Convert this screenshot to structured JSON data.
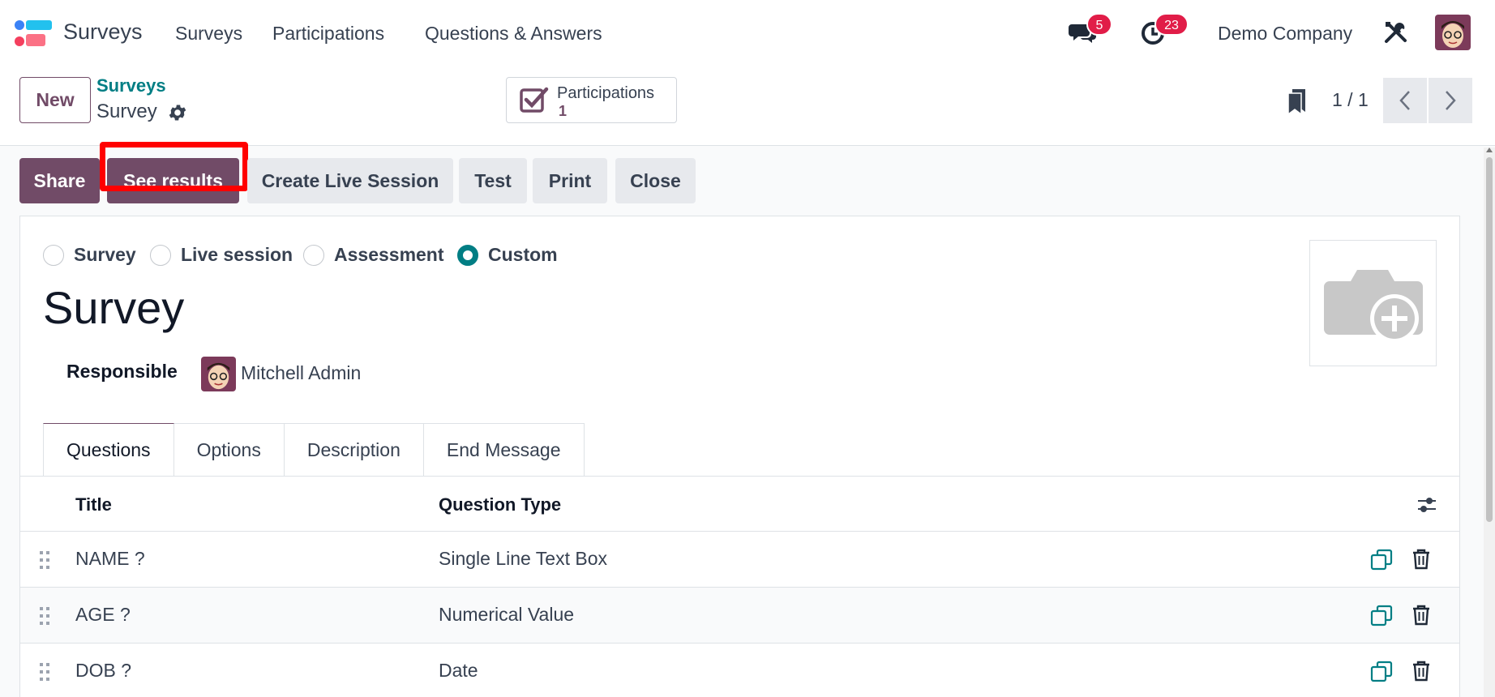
{
  "navbar": {
    "app_name": "Surveys",
    "menu": [
      "Surveys",
      "Participations",
      "Questions & Answers"
    ],
    "messages_badge": "5",
    "activities_badge": "23",
    "company": "Demo Company"
  },
  "control_panel": {
    "new_label": "New",
    "breadcrumb_parent": "Surveys",
    "breadcrumb_current": "Survey",
    "stat_label": "Participations",
    "stat_value": "1",
    "pager_value": "1 / 1"
  },
  "statusbar": {
    "share": "Share",
    "see_results": "See results",
    "create_live_session": "Create Live Session",
    "test": "Test",
    "print": "Print",
    "close": "Close"
  },
  "form": {
    "survey_types": [
      {
        "label": "Survey",
        "checked": false
      },
      {
        "label": "Live session",
        "checked": false
      },
      {
        "label": "Assessment",
        "checked": false
      },
      {
        "label": "Custom",
        "checked": true
      }
    ],
    "title": "Survey",
    "responsible_label": "Responsible",
    "responsible_name": "Mitchell Admin",
    "tabs": [
      "Questions",
      "Options",
      "Description",
      "End Message"
    ],
    "active_tab": "Questions"
  },
  "table": {
    "columns": [
      "Title",
      "Question Type"
    ],
    "rows": [
      {
        "title": "NAME ?",
        "type": "Single Line Text Box"
      },
      {
        "title": "AGE ?",
        "type": "Numerical Value"
      },
      {
        "title": "DOB ?",
        "type": "Date"
      }
    ]
  },
  "colors": {
    "brand": "#714b67",
    "accent": "#017e84",
    "badge": "#e11d48",
    "highlight": "#ff0000"
  },
  "icons": [
    "surveys-app-logo",
    "chat-icon",
    "clock-icon",
    "tools-icon",
    "gear-icon",
    "checkbox-icon",
    "bookmark-icon",
    "chevron-left-icon",
    "chevron-right-icon",
    "camera-plus-icon",
    "column-settings-icon",
    "drag-handle-icon",
    "duplicate-icon",
    "trash-icon"
  ]
}
